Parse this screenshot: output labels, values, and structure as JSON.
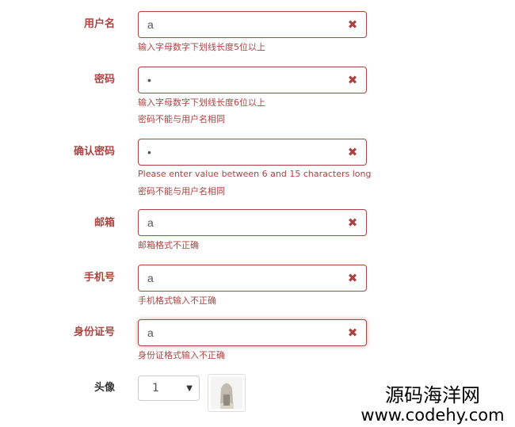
{
  "form": {
    "username": {
      "label": "用户名",
      "value": "a",
      "errors": [
        "输入字母数字下划线长度5位以上"
      ]
    },
    "password": {
      "label": "密码",
      "value": "•",
      "errors": [
        "输入字母数字下划线长度6位以上",
        "密码不能与用户名相同"
      ]
    },
    "confirm_password": {
      "label": "确认密码",
      "value": "•",
      "errors": [
        "Please enter value between 6 and 15 characters long",
        "密码不能与用户名相同"
      ]
    },
    "email": {
      "label": "邮箱",
      "value": "a",
      "errors": [
        "邮箱格式不正确"
      ]
    },
    "phone": {
      "label": "手机号",
      "value": "a",
      "errors": [
        "手机格式输入不正确"
      ]
    },
    "id_card": {
      "label": "身份证号",
      "value": "a",
      "errors": [
        "身份证格式输入不正确"
      ]
    },
    "avatar": {
      "label": "头像",
      "selected": "1"
    },
    "clear_icon": "close-icon",
    "error_color": "#a94442"
  },
  "watermark": {
    "line1": "源码海洋网",
    "line2": "www.codehy.com"
  }
}
